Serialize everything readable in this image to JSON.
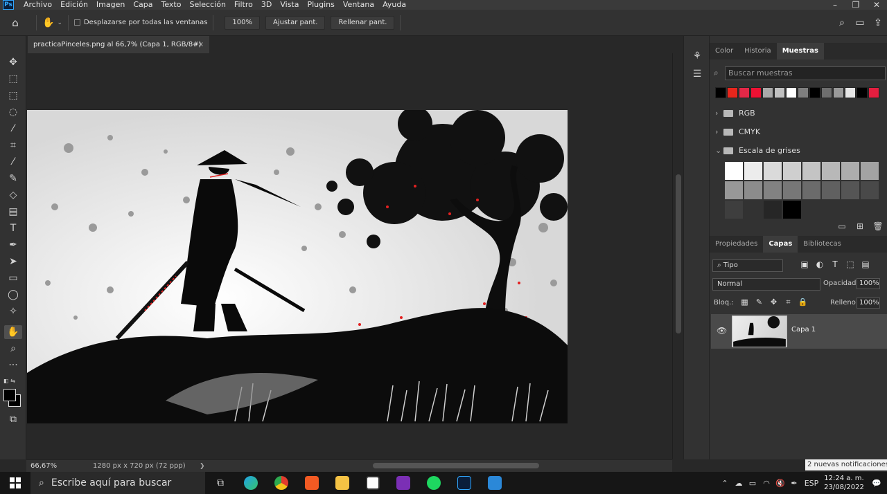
{
  "menubar": {
    "logo": "Ps",
    "items": [
      "Archivo",
      "Edición",
      "Imagen",
      "Capa",
      "Texto",
      "Selección",
      "Filtro",
      "3D",
      "Vista",
      "Plugins",
      "Ventana",
      "Ayuda"
    ]
  },
  "options": {
    "scroll_all_label": "Desplazarse por todas las ventanas",
    "zoom_button": "100%",
    "fit_screen_button": "Ajustar pant.",
    "fill_screen_button": "Rellenar pant."
  },
  "document": {
    "tab_title": "practicaPinceles.png al 66,7% (Capa 1, RGB/8#)",
    "close": "×"
  },
  "status": {
    "zoom": "66,67%",
    "dimensions": "1280 px x 720 px (72 ppp)",
    "arrow": "❯"
  },
  "swatch_panel": {
    "tabs": [
      "Color",
      "Historia",
      "Muestras"
    ],
    "search_placeholder": "Buscar muestras",
    "swatch_colors": [
      "#000000",
      "#e8261c",
      "#e32847",
      "#ee1133",
      "#a9a9a9",
      "#c0c0c0",
      "#ffffff",
      "#7f7f7f",
      "#000000",
      "#6e6e6e",
      "#9a9a9a",
      "#e6e6e6",
      "#000000",
      "#e41e3f"
    ],
    "groups": [
      "RGB",
      "CMYK",
      "Escala de grises"
    ],
    "grays": [
      "#ffffff",
      "#ececec",
      "#dadada",
      "#cfcfcf",
      "#c4c4c4",
      "#b8b8b8",
      "#adadad",
      "#a3a3a3",
      "#989898",
      "#8c8c8c",
      "#828282",
      "#777777",
      "#6b6b6b",
      "#606060",
      "#555555",
      "#494949",
      "#3e3e3e",
      "#323232",
      "#262626",
      "#000000"
    ]
  },
  "layers_panel": {
    "tabs": [
      "Propiedades",
      "Capas",
      "Bibliotecas"
    ],
    "filter_label": "Tipo",
    "blend_mode": "Normal",
    "opacity_label": "Opacidad:",
    "opacity_value": "100%",
    "lock_label": "Bloq.:",
    "fill_label": "Relleno:",
    "fill_value": "100%",
    "layer_name": "Capa 1"
  },
  "notification": {
    "text": "2 nuevas notificaciones"
  },
  "taskbar": {
    "search_placeholder": "Escribe aquí para buscar",
    "language": "ESP",
    "time": "12:24 a. m.",
    "date": "23/08/2022"
  }
}
